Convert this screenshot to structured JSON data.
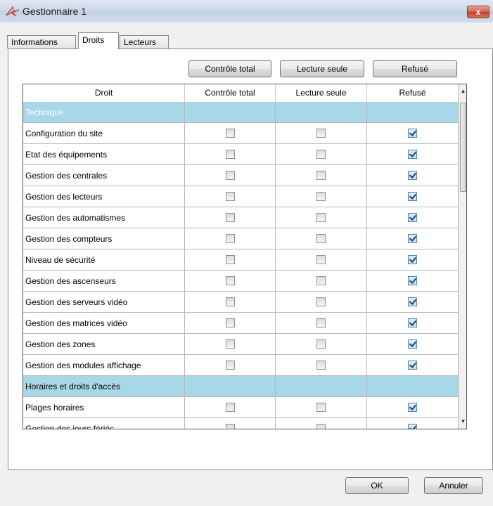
{
  "window": {
    "title": "Gestionnaire 1",
    "close_glyph": "x",
    "icon": "app-star-icon"
  },
  "tabs": [
    {
      "label": "Informations",
      "active": false
    },
    {
      "label": "Droits",
      "active": true
    },
    {
      "label": "Lecteurs",
      "active": false
    }
  ],
  "toolbar": {
    "full_control": "Contrôle total",
    "read_only": "Lecture seule",
    "denied": "Refusé"
  },
  "grid": {
    "columns": [
      "Droit",
      "Contrôle total",
      "Lecture seule",
      "Refusé"
    ],
    "rows": [
      {
        "label": "Technique",
        "group": true
      },
      {
        "label": "Configuration du site",
        "group": false,
        "checks": [
          false,
          false,
          true
        ]
      },
      {
        "label": "Etat des équipements",
        "group": false,
        "checks": [
          false,
          false,
          true
        ]
      },
      {
        "label": "Gestion des centrales",
        "group": false,
        "checks": [
          false,
          false,
          true
        ]
      },
      {
        "label": "Gestion des lecteurs",
        "group": false,
        "checks": [
          false,
          false,
          true
        ]
      },
      {
        "label": "Gestion des automatismes",
        "group": false,
        "checks": [
          false,
          false,
          true
        ]
      },
      {
        "label": "Gestion des compteurs",
        "group": false,
        "checks": [
          false,
          false,
          true
        ]
      },
      {
        "label": "Niveau de sécurité",
        "group": false,
        "checks": [
          false,
          false,
          true
        ]
      },
      {
        "label": "Gestion des ascenseurs",
        "group": false,
        "checks": [
          false,
          false,
          true
        ]
      },
      {
        "label": "Gestion des serveurs vidéo",
        "group": false,
        "checks": [
          false,
          false,
          true
        ]
      },
      {
        "label": "Gestion des matrices vidéo",
        "group": false,
        "checks": [
          false,
          false,
          true
        ]
      },
      {
        "label": "Gestion des zones",
        "group": false,
        "checks": [
          false,
          false,
          true
        ]
      },
      {
        "label": "Gestion des modules affichage",
        "group": false,
        "checks": [
          false,
          false,
          true
        ]
      },
      {
        "label": "Horaires et droits d'accès",
        "group": true
      },
      {
        "label": "Plages horaires",
        "group": false,
        "checks": [
          false,
          false,
          true
        ]
      },
      {
        "label": "Gestion des jours fériés",
        "group": false,
        "checks": [
          false,
          false,
          true
        ]
      }
    ]
  },
  "footer": {
    "ok": "OK",
    "cancel": "Annuler"
  },
  "colors": {
    "group_row": "#a8d8e8",
    "close_button": "#c1412b"
  }
}
